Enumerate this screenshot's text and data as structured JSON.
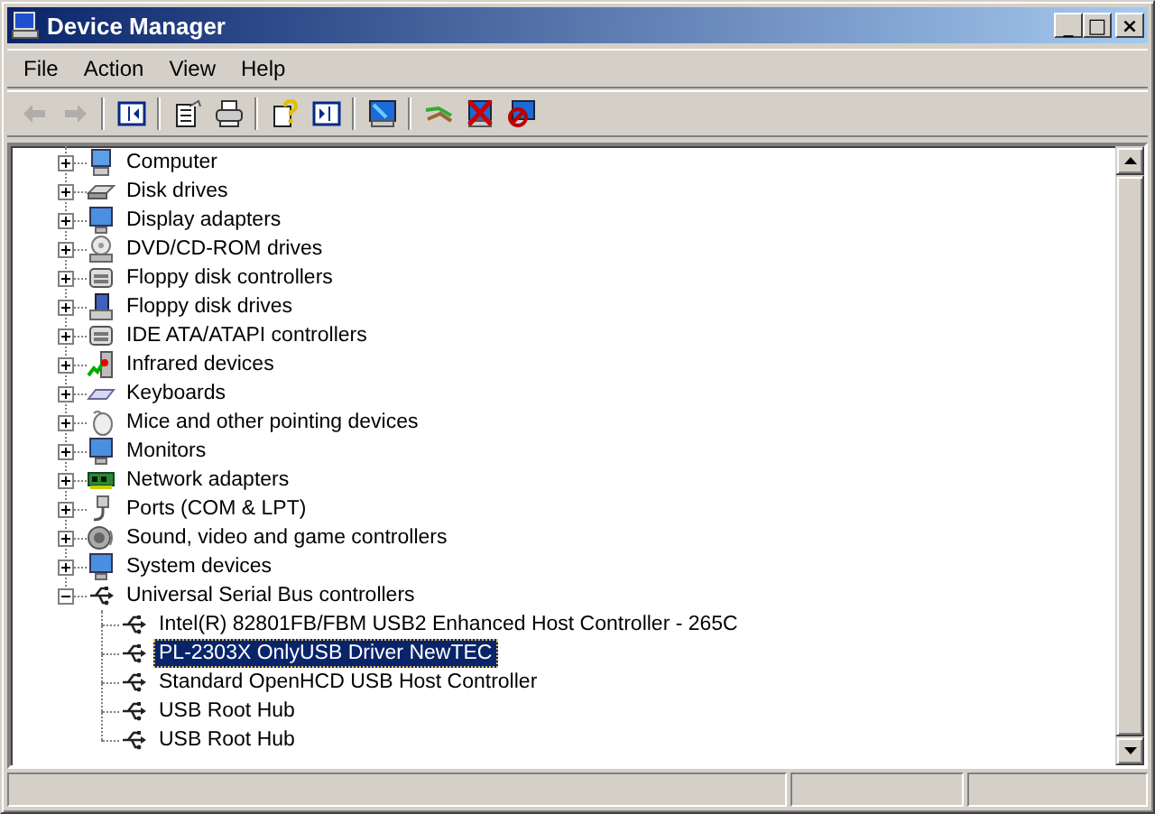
{
  "window": {
    "title": "Device Manager",
    "controls": [
      "_",
      "□",
      "×"
    ]
  },
  "menu": [
    {
      "label": "File"
    },
    {
      "label": "Action"
    },
    {
      "label": "View"
    },
    {
      "label": "Help"
    }
  ],
  "toolbar": [
    {
      "kind": "button",
      "disabled": true
    },
    {
      "kind": "button",
      "disabled": true
    },
    {
      "kind": "separator"
    },
    {
      "kind": "button",
      "disabled": false
    },
    {
      "kind": "separator"
    },
    {
      "kind": "button",
      "disabled": false
    },
    {
      "kind": "button",
      "disabled": false
    },
    {
      "kind": "separator"
    },
    {
      "kind": "button",
      "disabled": false
    },
    {
      "kind": "button",
      "disabled": false
    },
    {
      "kind": "separator"
    },
    {
      "kind": "button",
      "disabled": false
    },
    {
      "kind": "separator"
    },
    {
      "kind": "button",
      "disabled": false
    },
    {
      "kind": "button",
      "disabled": false
    },
    {
      "kind": "button",
      "disabled": false
    }
  ],
  "tree": [
    {
      "label": "Computer",
      "expanded": false,
      "selected": false
    },
    {
      "label": "Disk drives",
      "expanded": false,
      "selected": false
    },
    {
      "label": "Display adapters",
      "expanded": false,
      "selected": false
    },
    {
      "label": "DVD/CD-ROM drives",
      "expanded": false,
      "selected": false
    },
    {
      "label": "Floppy disk controllers",
      "expanded": false,
      "selected": false
    },
    {
      "label": "Floppy disk drives",
      "expanded": false,
      "selected": false
    },
    {
      "label": "IDE ATA/ATAPI controllers",
      "expanded": false,
      "selected": false
    },
    {
      "label": "Infrared devices",
      "expanded": false,
      "selected": false
    },
    {
      "label": "Keyboards",
      "expanded": false,
      "selected": false
    },
    {
      "label": "Mice and other pointing devices",
      "expanded": false,
      "selected": false
    },
    {
      "label": "Monitors",
      "expanded": false,
      "selected": false
    },
    {
      "label": "Network adapters",
      "expanded": false,
      "selected": false
    },
    {
      "label": "Ports (COM & LPT)",
      "expanded": false,
      "selected": false
    },
    {
      "label": "Sound, video and game controllers",
      "expanded": false,
      "selected": false
    },
    {
      "label": "System devices",
      "expanded": false,
      "selected": false
    },
    {
      "label": "Universal Serial Bus controllers",
      "expanded": true,
      "selected": false,
      "children": [
        {
          "label": "Intel(R) 82801FB/FBM USB2 Enhanced Host Controller - 265C",
          "selected": false
        },
        {
          "label": "PL-2303X OnlyUSB Driver NewTEC",
          "selected": true
        },
        {
          "label": "Standard OpenHCD USB Host Controller",
          "selected": false
        },
        {
          "label": "USB Root Hub",
          "selected": false
        },
        {
          "label": "USB Root Hub",
          "selected": false
        }
      ]
    }
  ]
}
